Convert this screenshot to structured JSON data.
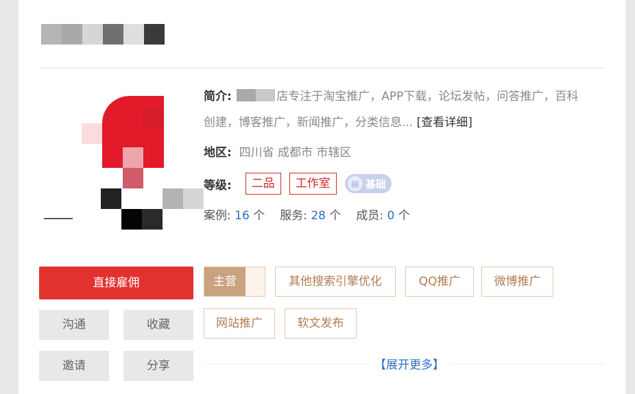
{
  "intro": {
    "label": "简介:",
    "text": "店专注于淘宝推广，APP下载，论坛发帖，问答推广，百科创建，博客推广，新闻推广，分类信息...",
    "more": "[查看详细]"
  },
  "region": {
    "label": "地区:",
    "value": "四川省 成都市 市辖区"
  },
  "grade": {
    "label": "等级:",
    "tags": [
      "二品",
      "工作室"
    ],
    "badge": "基础"
  },
  "stats": {
    "cases_label": "案例:",
    "cases_value": "16",
    "cases_unit": "个",
    "services_label": "服务:",
    "services_value": "28",
    "services_unit": "个",
    "members_label": "成员:",
    "members_value": "0",
    "members_unit": "个"
  },
  "actions": {
    "hire": "直接雇佣",
    "chat": "沟通",
    "favorite": "收藏",
    "invite": "邀请",
    "share": "分享"
  },
  "tags": {
    "main_label": "主营",
    "items": [
      "其他搜索引擎优化",
      "QQ推广",
      "微博推广",
      "网站推广",
      "软文发布"
    ]
  },
  "expand": "【展开更多】",
  "colors": {
    "primary_red": "#e2322f",
    "grade_red": "#d02a2a",
    "link_blue": "#2f6fc0",
    "tag_border": "#e3c9b0",
    "tag_text": "#b27d52"
  },
  "icons": [
    "shop-badge-icon"
  ]
}
